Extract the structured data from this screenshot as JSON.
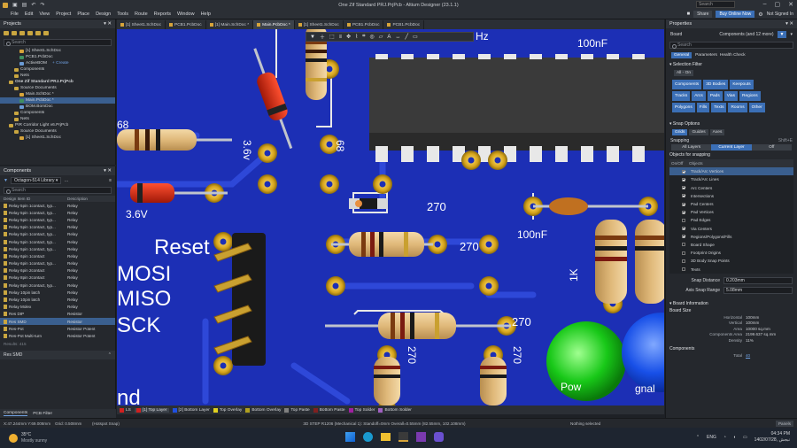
{
  "window": {
    "title": "One Zif Standard PRJ.PrjPcb - Altium Designer (23.1.1)"
  },
  "top_search": {
    "placeholder": "Search"
  },
  "menu": [
    "File",
    "Edit",
    "View",
    "Project",
    "Place",
    "Design",
    "Tools",
    "Route",
    "Reports",
    "Window",
    "Help"
  ],
  "top_right": {
    "share": "Share",
    "buy": "Buy Online Now",
    "user": "Not Signed In"
  },
  "projects_panel": {
    "title": "Projects",
    "search_placeholder": "Search",
    "tree": [
      {
        "label": "[1] Sheet1.SchDoc",
        "indent": 3,
        "color": "#d7a43a"
      },
      {
        "label": "PCB1.PcbDoc",
        "indent": 3,
        "color": "#3f8f5f"
      },
      {
        "label": "ActiveBOM",
        "indent": 3,
        "color": "#6a9ad4",
        "extra": "+ Create"
      },
      {
        "label": "Components",
        "indent": 2,
        "color": "#c9a640"
      },
      {
        "label": "Nets",
        "indent": 2,
        "color": "#c9a640"
      },
      {
        "label": "One Zif Standard PRJ.PrjPcb",
        "indent": 1,
        "color": "#c9a640",
        "bold": true
      },
      {
        "label": "Source Documents",
        "indent": 2,
        "color": "#c9a640"
      },
      {
        "label": "Main.SchDoc *",
        "indent": 3,
        "color": "#d7a43a"
      },
      {
        "label": "Main.PcbDoc *",
        "indent": 3,
        "color": "#3f8f5f",
        "selected": true
      },
      {
        "label": "BOM.BomDoc",
        "indent": 3,
        "color": "#6a9ad4"
      },
      {
        "label": "Components",
        "indent": 2,
        "color": "#c9a640"
      },
      {
        "label": "Nets",
        "indent": 2,
        "color": "#c9a640"
      },
      {
        "label": "PIR Corridor Light v6.PrjPcb",
        "indent": 1,
        "color": "#c9a640"
      },
      {
        "label": "Source Documents",
        "indent": 2,
        "color": "#c9a640"
      },
      {
        "label": "[1] Sheet1.SchDoc",
        "indent": 3,
        "color": "#d7a43a"
      }
    ]
  },
  "components_panel": {
    "title": "Components",
    "library": "Octagon-514 Library",
    "search_placeholder": "Search",
    "col_name": "Design Item ID",
    "col_desc": "Description",
    "rows": [
      [
        "Relay 5pin 1contact, typ...",
        "Relay"
      ],
      [
        "Relay 5pin 1contact, typ...",
        "Relay"
      ],
      [
        "Relay 5pin 1contact, typ...",
        "Relay"
      ],
      [
        "Relay 5pin 1contact, typ...",
        "Relay"
      ],
      [
        "Relay 5pin 1contact, typ...",
        "Relay"
      ],
      [
        "Relay 5pin 1contact, typ...",
        "Relay"
      ],
      [
        "Relay 5pin 1contact, typ...",
        "Relay"
      ],
      [
        "Relay 6pin 1contact",
        "Relay"
      ],
      [
        "Relay 6pin 1contact, typ...",
        "Relay"
      ],
      [
        "Relay 6pin 2contact",
        "Relay"
      ],
      [
        "Relay 8pin 2contact",
        "Relay"
      ],
      [
        "Relay 8pin 2contact, typ...",
        "Relay"
      ],
      [
        "Relay 10pin latch",
        "Relay"
      ],
      [
        "Relay 10pin latch",
        "Relay"
      ],
      [
        "Relay Molex",
        "Relay"
      ],
      [
        "Res DIP",
        "Resistor"
      ],
      [
        "Res SMD",
        "Resistor"
      ],
      [
        "Res-Pot",
        "Resistor Potent"
      ],
      [
        "Res-Pot Multi-turn",
        "Resistor Potent"
      ]
    ],
    "selected_index": 16,
    "results": "Results: 415",
    "selected_name": "Res SMD"
  },
  "left_tabs": [
    "Components",
    "PCB Filter"
  ],
  "doc_tabs": [
    {
      "label": "[1] Sheet1.SchDoc",
      "active": false
    },
    {
      "label": "PCB1.PcbDoc",
      "active": false
    },
    {
      "label": "[1] Main.SchDoc *",
      "active": false
    },
    {
      "label": "Main.PcbDoc *",
      "active": true
    },
    {
      "label": "[1] Sheet1.SchDoc",
      "active": false
    },
    {
      "label": "PCB1.PcbDoc",
      "active": false
    },
    {
      "label": "PCB1.PcbDoc",
      "active": false
    }
  ],
  "board_labels": {
    "reset": "Reset",
    "mosi": "MOSI",
    "miso": "MISO",
    "sck": "SCK",
    "gnd": "nd",
    "v36a": "3.6v",
    "v36b": "3.6V",
    "r68a": "68",
    "r68b": "68",
    "r270a": "270",
    "r270b": "270",
    "r270c": "270",
    "r270d": "270",
    "r270e": "270",
    "nf100a": "100nF",
    "nf100b": "100nF",
    "k1": "1K",
    "khz": "Hz",
    "pow": "Pow",
    "gnal": "gnal"
  },
  "layer_tabs": [
    {
      "label": "LS",
      "color": "#d02020",
      "active": false
    },
    {
      "label": "[1] Top Layer",
      "color": "#d02020",
      "active": true
    },
    {
      "label": "[2] Bottom Layer",
      "color": "#2050e0",
      "active": false
    },
    {
      "label": "Top Overlay",
      "color": "#e0d020",
      "active": false
    },
    {
      "label": "Bottom Overlay",
      "color": "#b0a020",
      "active": false
    },
    {
      "label": "Top Paste",
      "color": "#808080",
      "active": false
    },
    {
      "label": "Bottom Paste",
      "color": "#802020",
      "active": false
    },
    {
      "label": "Top Solder",
      "color": "#a020a0",
      "active": false
    },
    {
      "label": "Bottom Solder",
      "color": "#a060c0",
      "active": false
    }
  ],
  "status": {
    "coords": "X:47.244mm Y:69.008mm",
    "grid": "Grid: 0.508mm",
    "snap": "(Hotspot Snap)",
    "model": "3D STEP R1206 (Mechanical 1): Standoff=0mm  Overall=0.55mm (82.55mm, 102.108mm)",
    "selection": "Nothing selected",
    "panels": "Panels"
  },
  "properties": {
    "title": "Properties",
    "board_label": "Board",
    "board_value": "Components (and 12 more)",
    "search_placeholder": "Search",
    "tabs": [
      "General",
      "Parameters",
      "Health Check"
    ],
    "selection_filter_title": "Selection Filter",
    "all_on": "All - On",
    "filters": [
      {
        "label": "Components",
        "on": true
      },
      {
        "label": "3D Bodies",
        "on": true
      },
      {
        "label": "Keepouts",
        "on": true
      },
      {
        "label": "Tracks",
        "on": true
      },
      {
        "label": "Arcs",
        "on": true
      },
      {
        "label": "Pads",
        "on": true
      },
      {
        "label": "Vias",
        "on": true
      },
      {
        "label": "Regions",
        "on": true
      },
      {
        "label": "Polygons",
        "on": true
      },
      {
        "label": "Fills",
        "on": true
      },
      {
        "label": "Texts",
        "on": true
      },
      {
        "label": "Rooms",
        "on": true
      },
      {
        "label": "Other",
        "on": true
      }
    ],
    "snap_options_title": "Snap Options",
    "snap_modes": [
      {
        "label": "Grids",
        "on": true
      },
      {
        "label": "Guides",
        "on": false
      },
      {
        "label": "Axes",
        "on": false
      }
    ],
    "snapping_label": "Snapping",
    "snapping_shortcut": "Shift+E",
    "snapping_modes": [
      {
        "label": "All Layers",
        "on": false
      },
      {
        "label": "Current Layer",
        "on": true
      },
      {
        "label": "Off",
        "on": false
      }
    ],
    "objects_title": "Objects for snapping",
    "objects_hdr_onoff": "On/Off",
    "objects_hdr_objects": "Objects",
    "objects": [
      {
        "label": "Track/Arc Vertices",
        "checked": true,
        "selected": true
      },
      {
        "label": "Track/Arc Lines",
        "checked": true,
        "selected": false
      },
      {
        "label": "Arc Centers",
        "checked": true,
        "selected": false
      },
      {
        "label": "Intersections",
        "checked": true,
        "selected": false
      },
      {
        "label": "Pad Centers",
        "checked": true,
        "selected": false
      },
      {
        "label": "Pad Vertices",
        "checked": true,
        "selected": false
      },
      {
        "label": "Pad Edges",
        "checked": false,
        "selected": false
      },
      {
        "label": "Via Centers",
        "checked": true,
        "selected": false
      },
      {
        "label": "Regions/Polygons/Fills",
        "checked": true,
        "selected": false
      },
      {
        "label": "Board Shape",
        "checked": false,
        "selected": false
      },
      {
        "label": "Footprint Origins",
        "checked": false,
        "selected": false
      },
      {
        "label": "3D Body Snap Points",
        "checked": false,
        "selected": false
      },
      {
        "label": "Texts",
        "checked": false,
        "selected": false
      }
    ],
    "snap_distance_label": "Snap Distance",
    "snap_distance": "0.203mm",
    "axis_snap_label": "Axis Snap Range",
    "axis_snap": "5.08mm",
    "board_info_title": "Board Information",
    "board_size_title": "Board Size",
    "board_size": [
      [
        "Horizontal",
        "100mm"
      ],
      [
        "Vertical",
        "100mm"
      ],
      [
        "Area",
        "10000 sq.mm"
      ],
      [
        "Components Area",
        "2199.637 sq.mm"
      ],
      [
        "Density",
        "11%"
      ]
    ],
    "components_title": "Components",
    "total_label": "Total",
    "total_value": "40"
  },
  "taskbar": {
    "temp": "35°C",
    "weather": "Mostly sunny",
    "lang": "ENG",
    "time": "04:34 PM",
    "date": "1402/07/28, نبجش"
  }
}
